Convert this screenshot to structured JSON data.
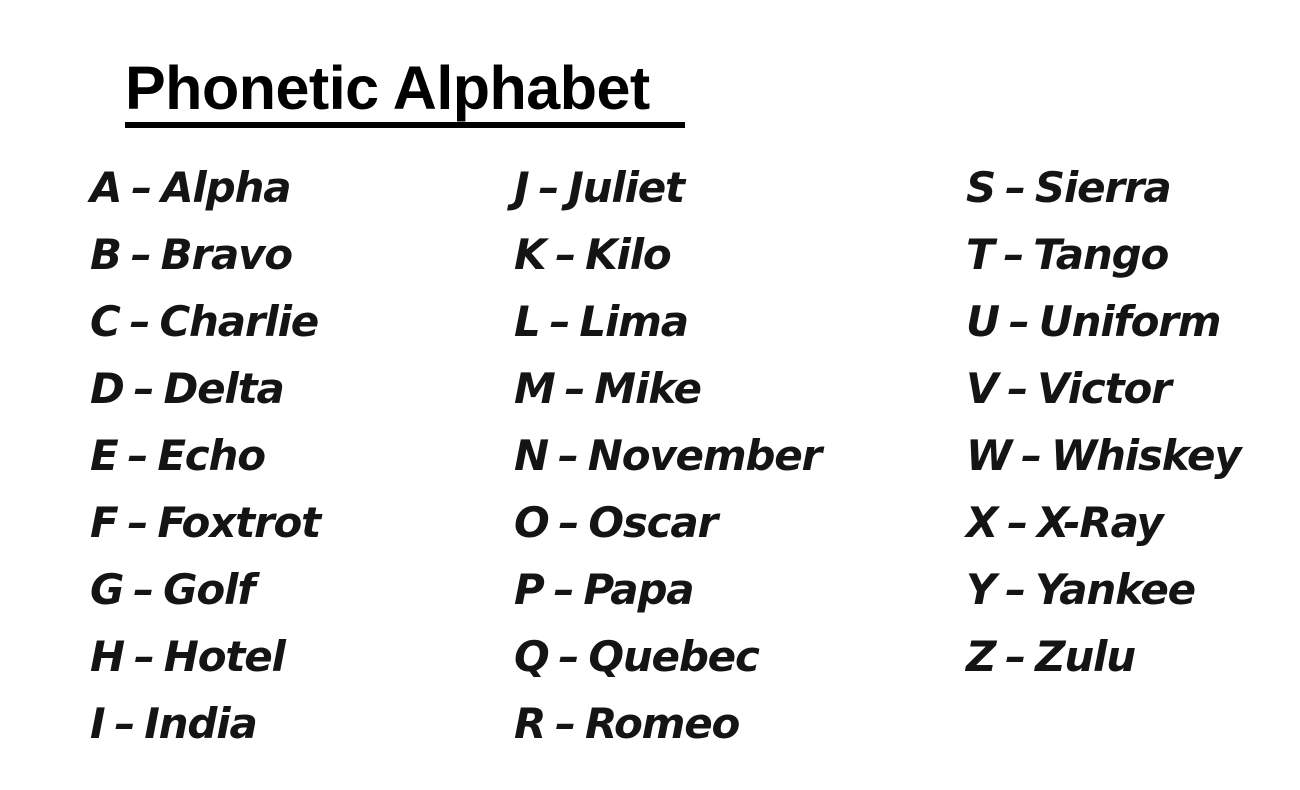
{
  "title": "Phonetic Alphabet",
  "separator": "–",
  "columns": [
    {
      "entries": [
        {
          "letter": "A",
          "word": "Alpha"
        },
        {
          "letter": "B",
          "word": "Bravo"
        },
        {
          "letter": "C",
          "word": "Charlie"
        },
        {
          "letter": "D",
          "word": "Delta"
        },
        {
          "letter": "E",
          "word": "Echo"
        },
        {
          "letter": "F",
          "word": "Foxtrot"
        },
        {
          "letter": "G",
          "word": "Golf"
        },
        {
          "letter": "H",
          "word": "Hotel"
        },
        {
          "letter": "I",
          "word": "India"
        }
      ]
    },
    {
      "entries": [
        {
          "letter": "J",
          "word": "Juliet"
        },
        {
          "letter": "K",
          "word": "Kilo"
        },
        {
          "letter": "L",
          "word": "Lima"
        },
        {
          "letter": "M",
          "word": "Mike"
        },
        {
          "letter": "N",
          "word": "November"
        },
        {
          "letter": "O",
          "word": "Oscar"
        },
        {
          "letter": "P",
          "word": "Papa"
        },
        {
          "letter": "Q",
          "word": "Quebec"
        },
        {
          "letter": "R",
          "word": "Romeo"
        }
      ]
    },
    {
      "entries": [
        {
          "letter": "S",
          "word": "Sierra"
        },
        {
          "letter": "T",
          "word": "Tango"
        },
        {
          "letter": "U",
          "word": "Uniform"
        },
        {
          "letter": "V",
          "word": "Victor"
        },
        {
          "letter": "W",
          "word": "Whiskey"
        },
        {
          "letter": "X",
          "word": "X-Ray"
        },
        {
          "letter": "Y",
          "word": "Yankee"
        },
        {
          "letter": "Z",
          "word": "Zulu"
        }
      ]
    }
  ]
}
